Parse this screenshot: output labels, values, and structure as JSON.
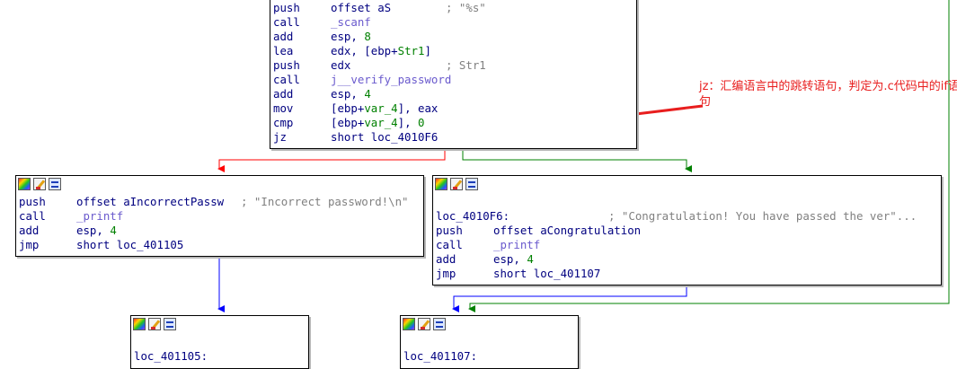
{
  "colors": {
    "red_edge": "#ff0000",
    "green_edge": "#008000",
    "blue_edge": "#0000ff",
    "annotation": "#e81e1e"
  },
  "top_block": [
    {
      "m": "push",
      "o": "offset aS",
      "c": "; \"%s\""
    },
    {
      "m": "call",
      "o": "_scanf",
      "c": ""
    },
    {
      "m": "add",
      "o": "esp, 8",
      "c": ""
    },
    {
      "m": "lea",
      "o": "edx, [ebp+Str1]",
      "c": ""
    },
    {
      "m": "push",
      "o": "edx",
      "c": "; Str1"
    },
    {
      "m": "call",
      "o": "j__verify_password",
      "c": ""
    },
    {
      "m": "add",
      "o": "esp, 4",
      "c": ""
    },
    {
      "m": "mov",
      "o": "[ebp+var_4], eax",
      "c": ""
    },
    {
      "m": "cmp",
      "o": "[ebp+var_4], 0",
      "c": ""
    },
    {
      "m": "jz",
      "o": "short loc_4010F6",
      "c": ""
    }
  ],
  "left_block": [
    {
      "m": "push",
      "o": "offset aIncorrectPassw",
      "c": "; \"Incorrect password!\\n\""
    },
    {
      "m": "call",
      "o": "_printf",
      "c": ""
    },
    {
      "m": "add",
      "o": "esp, 4",
      "c": ""
    },
    {
      "m": "jmp",
      "o": "short loc_401105",
      "c": ""
    }
  ],
  "right_block": {
    "label": "loc_4010F6:",
    "label_comment": "; \"Congratulation! You have passed the ver\"...",
    "lines": [
      {
        "m": "push",
        "o": "offset aCongratulation",
        "c": ""
      },
      {
        "m": "call",
        "o": "_printf",
        "c": ""
      },
      {
        "m": "add",
        "o": "esp, 4",
        "c": ""
      },
      {
        "m": "jmp",
        "o": "short loc_401107",
        "c": ""
      }
    ]
  },
  "bottom_left_label": "loc_401105:",
  "bottom_right_label": "loc_401107:",
  "annotation": "jz：汇编语言中的跳转语句，判定为.c代码中的if语句"
}
